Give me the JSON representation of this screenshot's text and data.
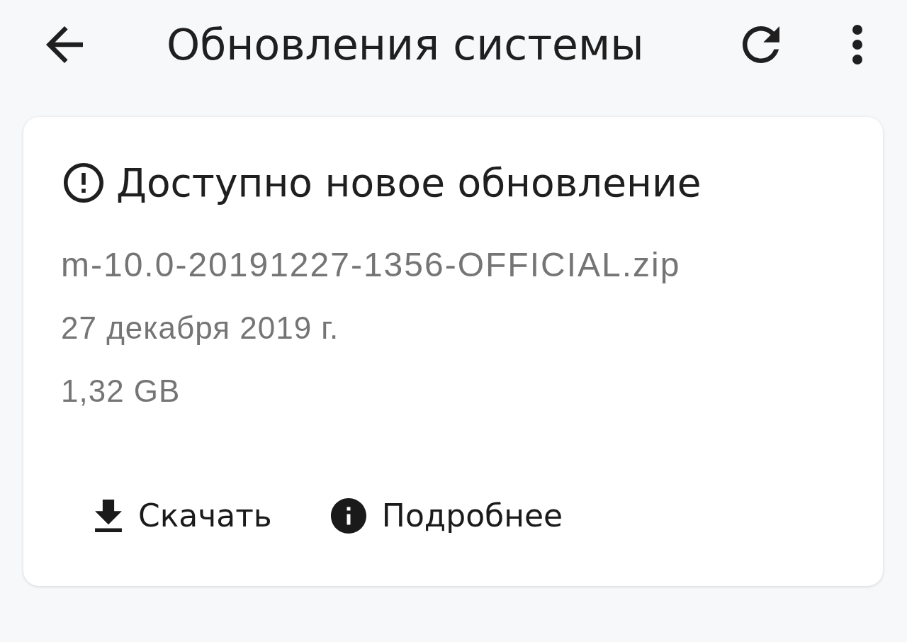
{
  "app_bar": {
    "title": "Обновления системы"
  },
  "update_card": {
    "headline": "Доступно новое обновление",
    "file_name": "m-10.0-20191227-1356-OFFICIAL.zip",
    "date": "27 декабря 2019 г.",
    "size": "1,32 GB",
    "actions": [
      {
        "kind": "download",
        "label": "Скачать"
      },
      {
        "kind": "info",
        "label": "Подробнее"
      }
    ]
  }
}
